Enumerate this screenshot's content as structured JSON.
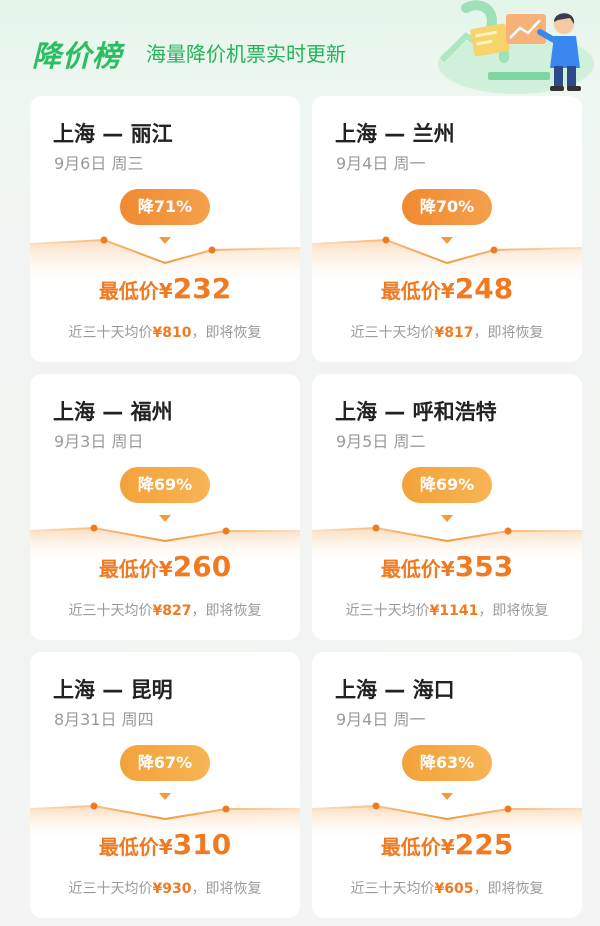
{
  "header": {
    "title": "降价榜",
    "subtitle": "海量降价机票实时更新"
  },
  "cards": [
    {
      "route": "上海 — 丽江",
      "date": "9月6日 周三",
      "badge": "降71%",
      "price_label": "最低价¥",
      "price": "232",
      "avg_prefix": "近三十天均价",
      "avg": "¥810",
      "avg_suffix": "，即将恢复"
    },
    {
      "route": "上海 — 兰州",
      "date": "9月4日 周一",
      "badge": "降70%",
      "price_label": "最低价¥",
      "price": "248",
      "avg_prefix": "近三十天均价",
      "avg": "¥817",
      "avg_suffix": "，即将恢复"
    },
    {
      "route": "上海 — 福州",
      "date": "9月3日 周日",
      "badge": "降69%",
      "price_label": "最低价¥",
      "price": "260",
      "avg_prefix": "近三十天均价",
      "avg": "¥827",
      "avg_suffix": "，即将恢复"
    },
    {
      "route": "上海 — 呼和浩特",
      "date": "9月5日 周二",
      "badge": "降69%",
      "price_label": "最低价¥",
      "price": "353",
      "avg_prefix": "近三十天均价",
      "avg": "¥1141",
      "avg_suffix": "，即将恢复"
    },
    {
      "route": "上海 — 昆明",
      "date": "8月31日 周四",
      "badge": "降67%",
      "price_label": "最低价¥",
      "price": "310",
      "avg_prefix": "近三十天均价",
      "avg": "¥930",
      "avg_suffix": "，即将恢复"
    },
    {
      "route": "上海 — 海口",
      "date": "9月4日 周一",
      "badge": "降63%",
      "price_label": "最低价¥",
      "price": "225",
      "avg_prefix": "近三十天均价",
      "avg": "¥605",
      "avg_suffix": "，即将恢复"
    }
  ],
  "colors": {
    "brand_green": "#2bbd62",
    "accent_orange": "#f07a22",
    "badge_orange": "#f08a30"
  },
  "icons": {
    "header_illustration": "person-presenting-chart-illustration"
  }
}
